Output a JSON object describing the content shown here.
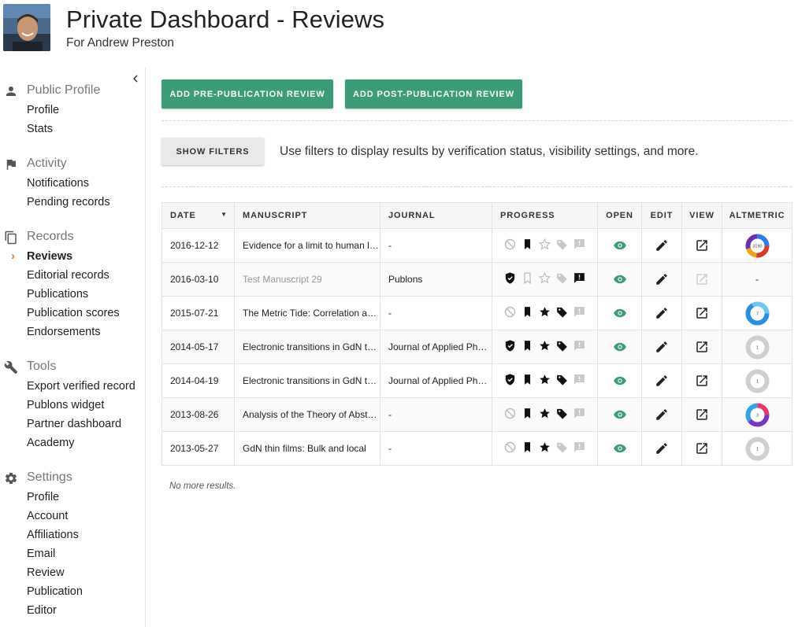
{
  "header": {
    "title": "Private Dashboard - Reviews",
    "subtitle": "For Andrew Preston"
  },
  "sidebar": {
    "sections": [
      {
        "title": "Public Profile",
        "icon": "person-icon",
        "items": [
          "Profile",
          "Stats"
        ]
      },
      {
        "title": "Activity",
        "icon": "flag-icon",
        "items": [
          "Notifications",
          "Pending records"
        ]
      },
      {
        "title": "Records",
        "icon": "copy-icon",
        "items": [
          "Reviews",
          "Editorial records",
          "Publications",
          "Publication scores",
          "Endorsements"
        ],
        "active": "Reviews"
      },
      {
        "title": "Tools",
        "icon": "wrench-icon",
        "items": [
          "Export verified record",
          "Publons widget",
          "Partner dashboard",
          "Academy"
        ]
      },
      {
        "title": "Settings",
        "icon": "gear-icon",
        "items": [
          "Profile",
          "Account",
          "Affiliations",
          "Email",
          "Review",
          "Publication",
          "Editor"
        ]
      }
    ]
  },
  "actions": {
    "add_pre": "ADD PRE-PUBLICATION REVIEW",
    "add_post": "ADD POST-PUBLICATION REVIEW",
    "show_filters": "SHOW FILTERS",
    "filter_hint": "Use filters to display results by verification status, visibility settings, and more."
  },
  "table": {
    "columns": [
      "DATE",
      "MANUSCRIPT",
      "JOURNAL",
      "PROGRESS",
      "OPEN",
      "EDIT",
      "VIEW",
      "ALTMETRIC"
    ],
    "rows": [
      {
        "date": "2016-12-12",
        "manuscript": "Evidence for a limit to human lifespan",
        "journal": "-",
        "verified": false,
        "bookmark": true,
        "star": false,
        "tag": false,
        "comment": false,
        "view_enabled": true,
        "altmetric": "3190",
        "altmetric_style": "multi"
      },
      {
        "date": "2016-03-10",
        "manuscript": "Test Manuscript 29",
        "manuscript_dim": true,
        "journal": "Publons",
        "verified": true,
        "bookmark": false,
        "star": false,
        "tag": false,
        "comment": true,
        "view_enabled": false,
        "altmetric": "-",
        "altmetric_style": "none"
      },
      {
        "date": "2015-07-21",
        "manuscript": "The Metric Tide: Correlation analysis",
        "journal": "-",
        "verified": false,
        "bookmark": true,
        "star": true,
        "tag": true,
        "comment": false,
        "view_enabled": true,
        "altmetric": "7",
        "altmetric_style": "blue"
      },
      {
        "date": "2014-05-17",
        "manuscript": "Electronic transitions in GdN thin films",
        "journal": "Journal of Applied Physics",
        "verified": true,
        "bookmark": true,
        "star": true,
        "tag": true,
        "comment": false,
        "view_enabled": true,
        "altmetric": "1",
        "altmetric_style": "grey"
      },
      {
        "date": "2014-04-19",
        "manuscript": "Electronic transitions in GdN thin films",
        "journal": "Journal of Applied Physics",
        "verified": true,
        "bookmark": true,
        "star": true,
        "tag": true,
        "comment": false,
        "view_enabled": true,
        "altmetric": "1",
        "altmetric_style": "grey"
      },
      {
        "date": "2013-08-26",
        "manuscript": "Analysis of the Theory of Abstract",
        "journal": "-",
        "verified": false,
        "bookmark": true,
        "star": true,
        "tag": true,
        "comment": false,
        "view_enabled": true,
        "altmetric": "3",
        "altmetric_style": "multi2"
      },
      {
        "date": "2013-05-27",
        "manuscript": "GdN thin films: Bulk and local",
        "journal": "-",
        "verified": false,
        "bookmark": true,
        "star": true,
        "tag": false,
        "comment": false,
        "view_enabled": true,
        "altmetric": "1",
        "altmetric_style": "grey"
      }
    ],
    "footer": "No more results."
  },
  "colors": {
    "accent_green": "#3c9c77",
    "eye_green": "#3c9c77",
    "active_arrow": "#e8772e"
  }
}
